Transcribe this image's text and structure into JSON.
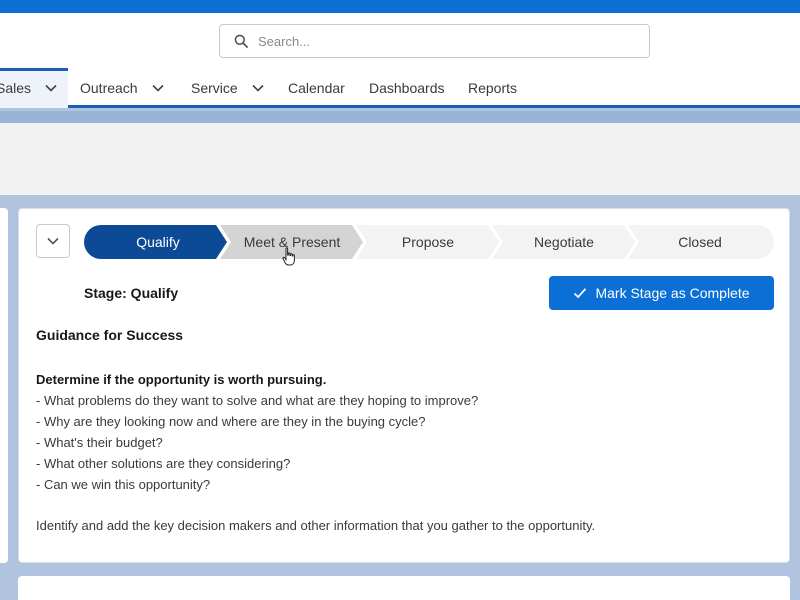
{
  "search": {
    "placeholder": "Search..."
  },
  "nav": {
    "items": [
      {
        "label": "Sales",
        "has_menu": true,
        "active": true
      },
      {
        "label": "Outreach",
        "has_menu": true,
        "active": false
      },
      {
        "label": "Service",
        "has_menu": true,
        "active": false
      },
      {
        "label": "Calendar",
        "has_menu": false,
        "active": false
      },
      {
        "label": "Dashboards",
        "has_menu": false,
        "active": false
      },
      {
        "label": "Reports",
        "has_menu": false,
        "active": false
      }
    ]
  },
  "path": {
    "stages": [
      {
        "label": "Qualify",
        "state": "current"
      },
      {
        "label": "Meet & Present",
        "state": "hover"
      },
      {
        "label": "Propose",
        "state": "incomplete"
      },
      {
        "label": "Negotiate",
        "state": "incomplete"
      },
      {
        "label": "Closed",
        "state": "incomplete"
      }
    ]
  },
  "stage": {
    "label": "Stage: Qualify",
    "complete_button": "Mark Stage as Complete"
  },
  "guidance": {
    "title": "Guidance for Success",
    "lead": "Determine if the opportunity is worth pursuing.",
    "questions": [
      "- What problems do they want to solve and what are they hoping to improve?",
      "- Why are they looking now and where are they in the buying cycle?",
      "- What's their budget?",
      "- What other solutions are they considering?",
      "- Can we win this opportunity?"
    ],
    "closing": "Identify and add the key decision makers and other information that you gather to the opportunity."
  },
  "colors": {
    "brand_blue": "#0b6fd6",
    "path_current": "#0d4a95",
    "path_hover": "#d4d4d4",
    "path_incomplete": "#f3f3f3"
  },
  "icons": {
    "search": "search-icon",
    "chevron": "chevron-down-icon",
    "check": "check-icon",
    "cursor": "hand-cursor-icon"
  }
}
